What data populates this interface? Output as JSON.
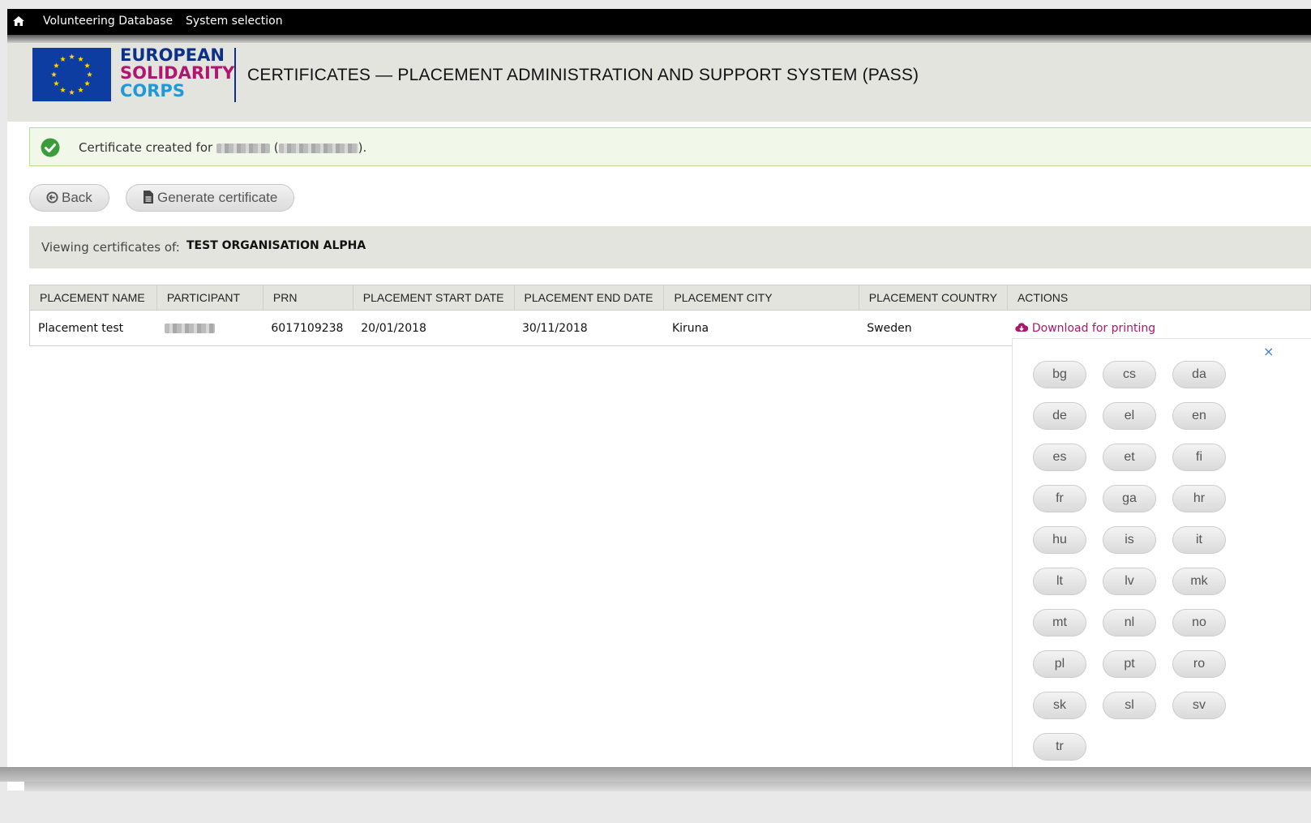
{
  "topbar": {
    "home_icon": "home-icon",
    "links": [
      "Volunteering Database",
      "System selection"
    ]
  },
  "header": {
    "logo": {
      "line1": "EUROPEAN",
      "line2": "SOLIDARITY",
      "line3": "CORPS"
    },
    "title": "CERTIFICATES — PLACEMENT ADMINISTRATION AND SUPPORT SYSTEM (PASS)"
  },
  "alert": {
    "icon": "check-circle-icon",
    "prefix": "Certificate created for ",
    "paren_open": " (",
    "suffix": ")."
  },
  "toolbar": {
    "back_label": "Back",
    "back_icon": "arrow-circle-left-icon",
    "generate_label": "Generate certificate",
    "generate_icon": "file-icon"
  },
  "viewing": {
    "label": "Viewing certificates of:",
    "organisation": "TEST ORGANISATION ALPHA"
  },
  "table": {
    "columns": [
      "PLACEMENT NAME",
      "PARTICIPANT",
      "PRN",
      "PLACEMENT START DATE",
      "PLACEMENT END DATE",
      "PLACEMENT CITY",
      "PLACEMENT COUNTRY",
      "ACTIONS"
    ],
    "rows": [
      {
        "placement_name": "Placement test",
        "prn": "6017109238",
        "start_date": "20/01/2018",
        "end_date": "30/11/2018",
        "city": "Kiruna",
        "country": "Sweden",
        "action": "Download for printing",
        "action_icon": "cloud-download-icon"
      }
    ]
  },
  "languages": {
    "close_label": "×",
    "codes": [
      "bg",
      "cs",
      "da",
      "de",
      "el",
      "en",
      "es",
      "et",
      "fi",
      "fr",
      "ga",
      "hr",
      "hu",
      "is",
      "it",
      "lt",
      "lv",
      "mk",
      "mt",
      "nl",
      "no",
      "pl",
      "pt",
      "ro",
      "sk",
      "sl",
      "sv",
      "tr"
    ]
  },
  "colors": {
    "topbar": "#000000",
    "header_bg": "#e4e4df",
    "success_bg": "#f1f8e9",
    "success_icon": "#3b9c3b",
    "link_accent": "#a8186b",
    "eu_blue": "#0c2f8a",
    "eu_magenta": "#b0156f",
    "eu_cyan": "#1f9ad6"
  }
}
